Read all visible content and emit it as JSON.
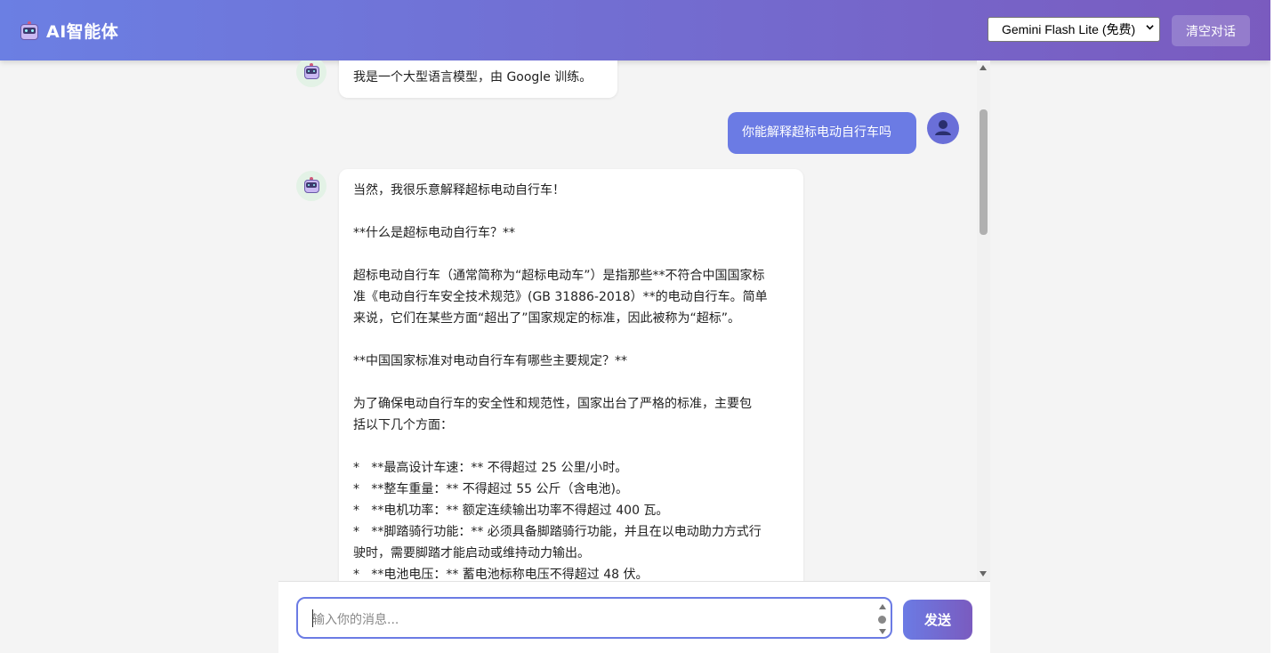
{
  "header": {
    "title": "AI智能体",
    "model_selected": "Gemini Flash Lite (免费)",
    "clear_label": "清空对话"
  },
  "messages": [
    {
      "role": "bot",
      "lines": [
        "我是一个大型语言模型，由 Google 训练。"
      ]
    },
    {
      "role": "user",
      "lines": [
        "你能解释超标电动自行车吗"
      ]
    },
    {
      "role": "bot",
      "lines": [
        "当然，我很乐意解释超标电动自行车！",
        "",
        "**什么是超标电动自行车？**",
        "",
        "超标电动自行车（通常简称为“超标电动车”）是指那些**不符合中国国家标",
        "准《电动自行车安全技术规范》(GB 31886-2018）**的电动自行车。简单",
        "来说，它们在某些方面“超出了”国家规定的标准，因此被称为“超标”。",
        "",
        "**中国国家标准对电动自行车有哪些主要规定？**",
        "",
        "为了确保电动自行车的安全性和规范性，国家出台了严格的标准，主要包",
        "括以下几个方面：",
        "",
        "*   **最高设计车速：** 不得超过 25 公里/小时。",
        "*   **整车重量：** 不得超过 55 公斤（含电池)。",
        "*   **电机功率：** 额定连续输出功率不得超过 400 瓦。",
        "*   **脚踏骑行功能：** 必须具备脚踏骑行功能，并且在以电动助力方式行",
        "驶时，需要脚踏才能启动或维持动力输出。",
        "*   **电池电压：** 蓄电池标称电压不得超过 48 伏。"
      ]
    }
  ],
  "input": {
    "placeholder": "输入你的消息...",
    "send_label": "发送"
  }
}
